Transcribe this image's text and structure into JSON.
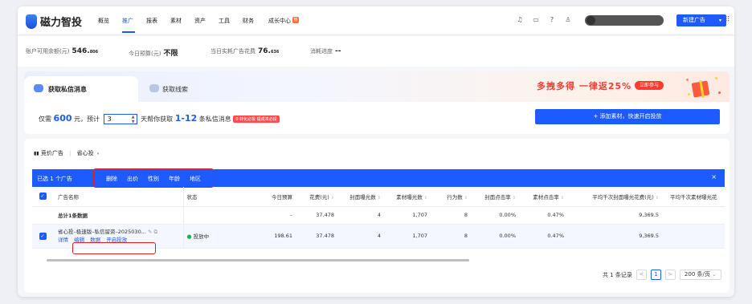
{
  "app": {
    "name": "磁力智投"
  },
  "nav": {
    "items": [
      "概览",
      "推广",
      "报表",
      "素材",
      "资产",
      "工具",
      "财务",
      "成长中心"
    ],
    "active": "推广",
    "hot_badge": "热",
    "new_ad_label": "新建广告"
  },
  "stats": {
    "balance_label": "账户可用余额(元)",
    "balance_value": "546.",
    "balance_decimal": "806",
    "budget_label": "今日预算(元)",
    "budget_value": "不限",
    "spend_label": "当日实耗广告花费",
    "spend_value": "76.",
    "spend_decimal": "636",
    "progress_label": "消耗进度",
    "progress_value": "--"
  },
  "campaign_card": {
    "tab_active": "获取私信消息",
    "tab_inactive": "获取线索",
    "promo_text": "多拽多得 一律返25%",
    "promo_button": "立即参与",
    "estimate_prefix": "仅需",
    "estimate_amount": "600",
    "estimate_mid": "元，预计",
    "days_value": "3",
    "estimate_mid2": "天帮你获取",
    "estimate_range": "1-12",
    "estimate_suffix": "条私信消息",
    "tag": "0 转化必投 提成本必投",
    "add_button": "+ 添加素材，快速开启投放"
  },
  "list": {
    "filter_type": "竞价广告",
    "filter_mode": "省心投",
    "selected_text": "已选 1 个广告",
    "actions": [
      "删除",
      "出价",
      "性别",
      "年龄",
      "地区"
    ],
    "close_icon": "×",
    "columns": [
      "广告名称",
      "状态",
      "今日预算",
      "花费(元)",
      "封面曝光数",
      "素材曝光数",
      "行为数",
      "封面点击率",
      "素材点击率",
      "平均千次封面曝光花费(元)",
      "平均千次素材曝光花"
    ],
    "summary_row": {
      "label": "总计1条数据",
      "budget": "–",
      "spend": "37.478",
      "cover_impr": "4",
      "material_impr": "1,707",
      "actions": "8",
      "cover_ctr": "0.00%",
      "material_ctr": "0.47%",
      "cpm_cover": "9,369.5"
    },
    "ad_row": {
      "name": "省心投–极速版–私信留资–2025030...",
      "ops": [
        "详情",
        "编辑",
        "数据",
        "开启投放"
      ],
      "status": "投放中",
      "budget": "198.61",
      "spend": "37.478",
      "cover_impr": "4",
      "material_impr": "1,707",
      "actions": "8",
      "cover_ctr": "0.00%",
      "material_ctr": "0.47%",
      "cpm_cover": "9,369.5"
    }
  },
  "pagination": {
    "total": "共 1 条记录",
    "prev": "<",
    "current": "1",
    "next": ">",
    "page_size": "200 条/页"
  },
  "colors": {
    "brand_blue": "#1e5bff",
    "promo_red": "#ff3b30",
    "status_green": "#22b14c"
  }
}
